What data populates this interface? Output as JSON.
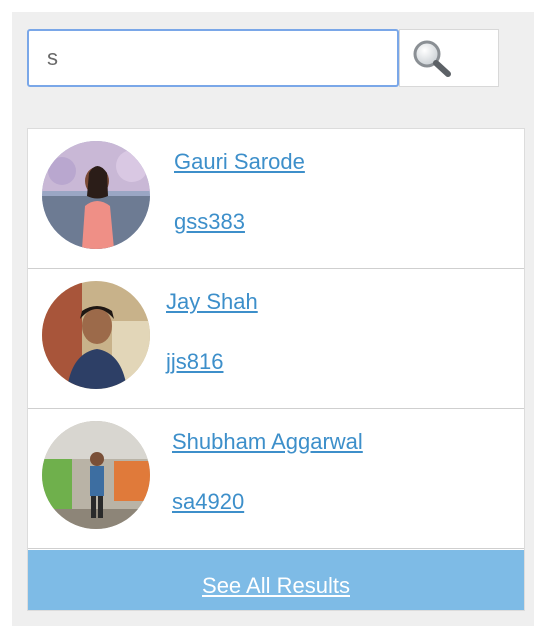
{
  "search": {
    "value": "s",
    "placeholder": ""
  },
  "icons": {
    "search_button": "magnifier-icon"
  },
  "results": [
    {
      "name": "Gauri Sarode",
      "username": "gss383",
      "avatar": "profile-photo"
    },
    {
      "name": "Jay Shah",
      "username": "jjs816",
      "avatar": "profile-photo"
    },
    {
      "name": "Shubham Aggarwal",
      "username": "sa4920",
      "avatar": "profile-photo"
    }
  ],
  "footer": {
    "see_all_label": "See All Results"
  },
  "colors": {
    "link": "#3d8fca",
    "footer_bg": "#7ebbe6",
    "input_border": "#7aa7e8",
    "panel_bg": "#efefef"
  }
}
